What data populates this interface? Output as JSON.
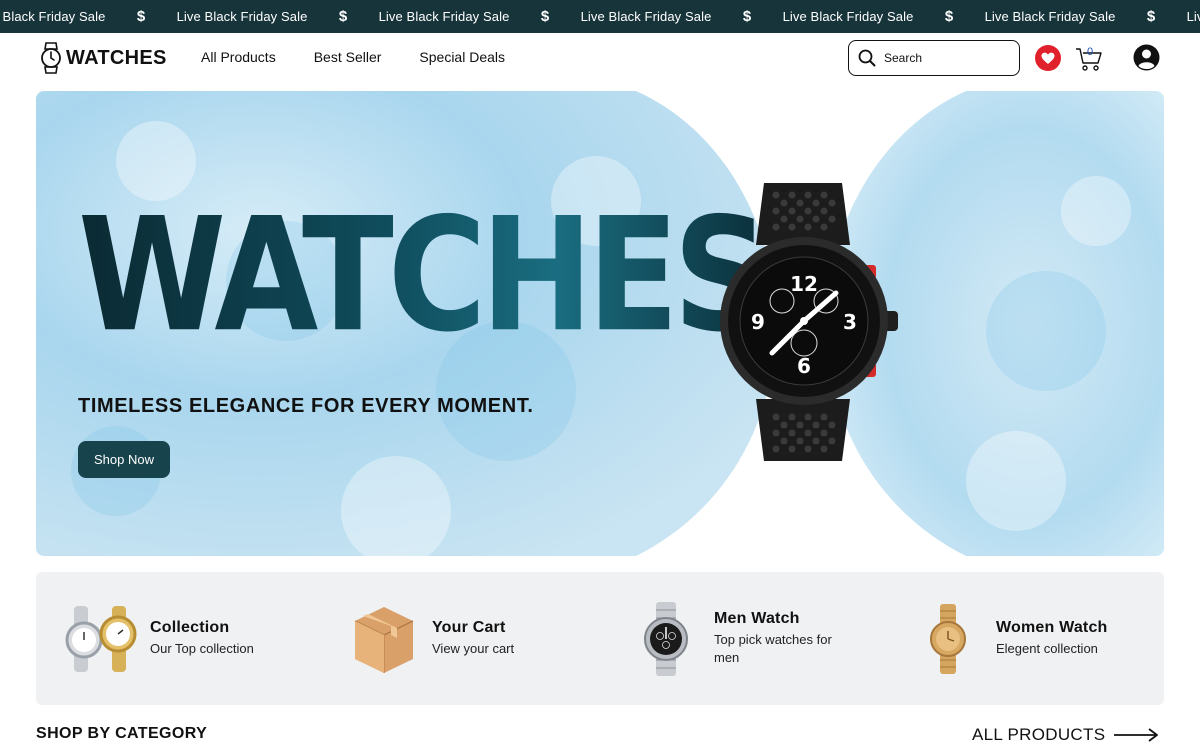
{
  "ticker": {
    "items": [
      "Live Black Friday Sale",
      "Live Black Friday Sale",
      "Live Black Friday Sale",
      "Live Black Friday Sale",
      "Live Black Friday Sale",
      "Live Black Friday Sale",
      "Live Black Friday Sale"
    ],
    "separator": "$"
  },
  "header": {
    "logo_text": "WATCHES",
    "nav": [
      "All Products",
      "Best Seller",
      "Special Deals"
    ],
    "search_placeholder": "Search",
    "cart_count": "0"
  },
  "hero": {
    "title": "WATCHES",
    "subtitle": "TIMELESS ELEGANCE FOR EVERY MOMENT.",
    "button": "Shop Now"
  },
  "features": [
    {
      "title": "Collection",
      "desc": "Our Top collection"
    },
    {
      "title": "Your Cart",
      "desc": "View your cart"
    },
    {
      "title": "Men Watch",
      "desc": "Top pick watches for men"
    },
    {
      "title": "Women Watch",
      "desc": "Elegent collection"
    }
  ],
  "sections": {
    "shop_by_category": "SHOP BY CATEGORY",
    "all_products": "ALL PRODUCTS"
  },
  "colors": {
    "ticker_bg": "#17343a",
    "accent_button": "#17434c",
    "heart": "#e0202a",
    "feature_bg": "#f0f1f3"
  }
}
